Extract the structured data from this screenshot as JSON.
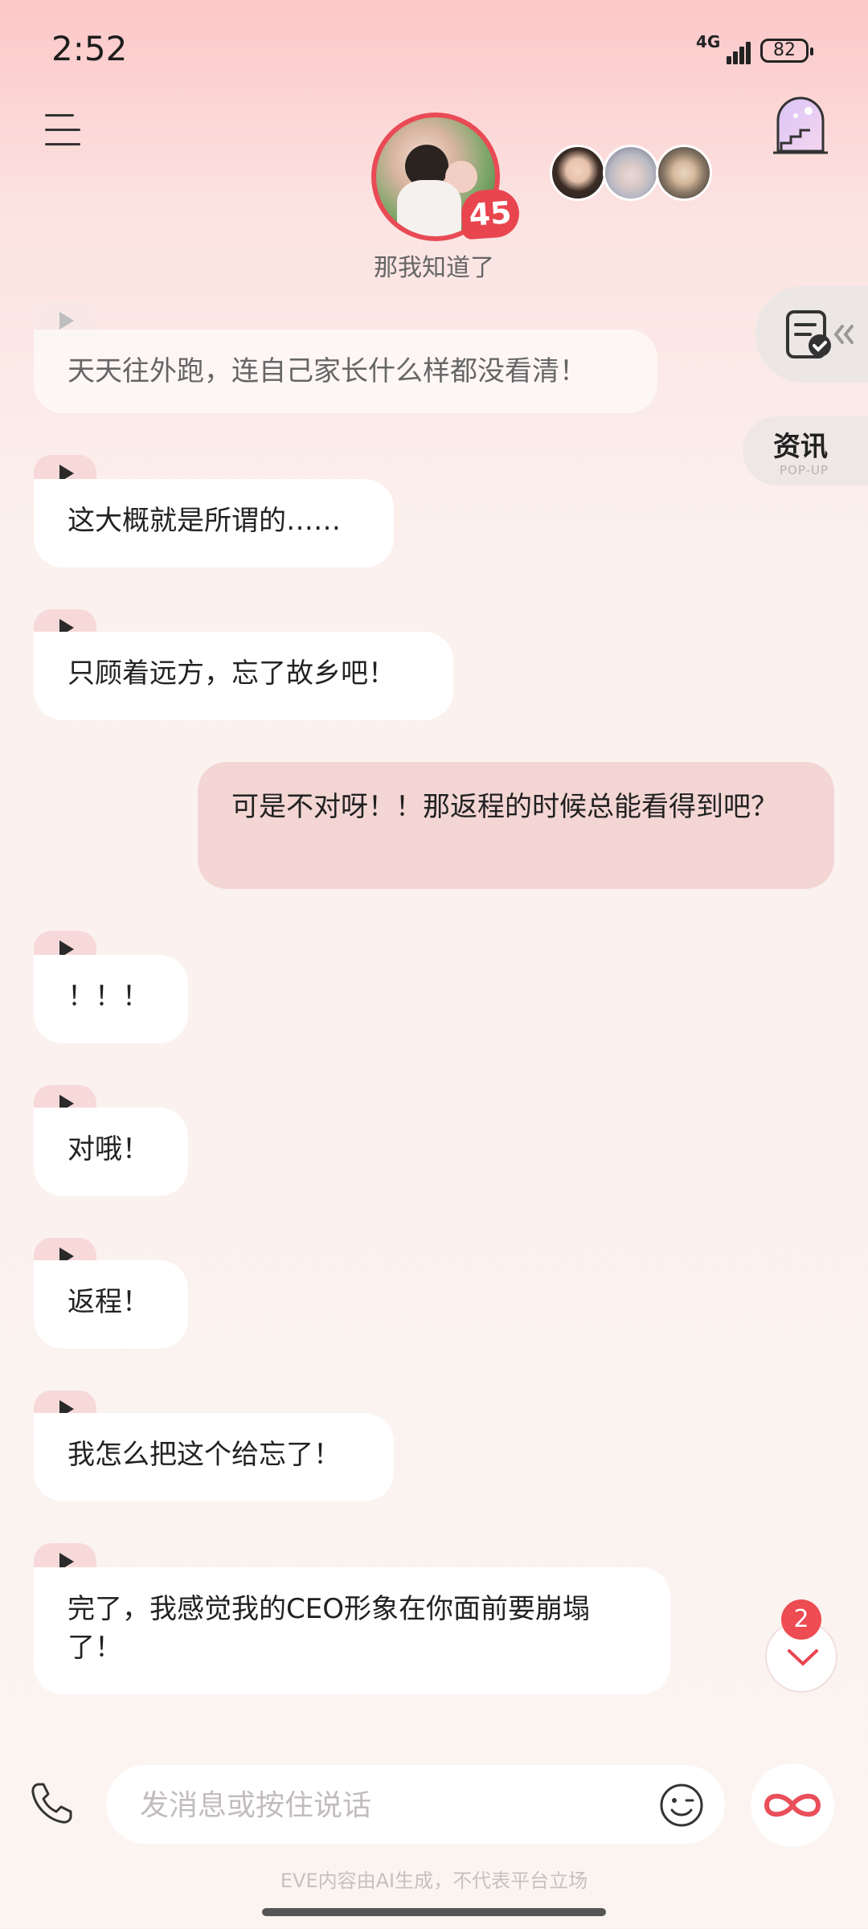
{
  "status_bar": {
    "time": "2:52",
    "network": "4G",
    "battery": "82"
  },
  "header": {
    "level": "45",
    "status_text": "那我知道了"
  },
  "side_panel": {
    "news_title": "资讯",
    "news_subtitle": "POP-UP"
  },
  "messages": [
    {
      "role": "ai",
      "text": "天天往外跑，连自己家长什么样都没看清！"
    },
    {
      "role": "ai",
      "text": "这大概就是所谓的……"
    },
    {
      "role": "ai",
      "text": "只顾着远方，忘了故乡吧！"
    },
    {
      "role": "user",
      "text": "可是不对呀！！那返程的时候总能看得到吧？"
    },
    {
      "role": "ai",
      "text": "！！！"
    },
    {
      "role": "ai",
      "text": "对哦！"
    },
    {
      "role": "ai",
      "text": "返程！"
    },
    {
      "role": "ai",
      "text": "我怎么把这个给忘了！"
    },
    {
      "role": "ai",
      "text": "完了，我感觉我的CEO形象在你面前要崩塌了！"
    }
  ],
  "scroll": {
    "unread_count": "2"
  },
  "input_bar": {
    "placeholder": "发消息或按住说话"
  },
  "footer": {
    "note": "EVE内容由AI生成，不代表平台立场"
  },
  "colors": {
    "accent": "#e94a55",
    "user_bubble": "#f3d6d4",
    "ai_bubble": "#ffffff"
  }
}
